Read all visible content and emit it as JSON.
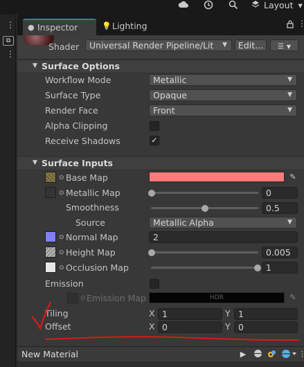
{
  "toolbar": {
    "cloud_icon": "cloud-icon",
    "history_icon": "history-icon",
    "search_icon": "search-icon",
    "layers_icon": "layers-icon",
    "layout_label": "Layout",
    "layout_arrow": "▾"
  },
  "tabs": {
    "inspector_label": "Inspector",
    "lighting_label": "Lighting",
    "lock_icon": "🔒",
    "menu_icon": "⋮"
  },
  "left_strip": {
    "kebab": "⋮",
    "scene_icon": "⧉"
  },
  "shader": {
    "label": "Shader",
    "value": "Universal Render Pipeline/Lit",
    "edit_button": "Edit...",
    "list_button": "☰"
  },
  "surface_options": {
    "title": "Surface Options",
    "workflow_mode_label": "Workflow Mode",
    "workflow_mode_value": "Metallic",
    "surface_type_label": "Surface Type",
    "surface_type_value": "Opaque",
    "render_face_label": "Render Face",
    "render_face_value": "Front",
    "alpha_clipping_label": "Alpha Clipping",
    "alpha_clipping_checked": false,
    "receive_shadows_label": "Receive Shadows",
    "receive_shadows_checked": true,
    "check_glyph": "✓"
  },
  "surface_inputs": {
    "title": "Surface Inputs",
    "base_map_label": "Base Map",
    "base_map_color": "#ff7b7b",
    "metallic_map_label": "Metallic Map",
    "metallic_value": "0",
    "metallic_fraction": 0.0,
    "smoothness_label": "Smoothness",
    "smoothness_value": "0.5",
    "smoothness_fraction": 0.5,
    "source_label": "Source",
    "source_value": "Metallic Alpha",
    "normal_map_label": "Normal Map",
    "normal_value": "2",
    "height_map_label": "Height Map",
    "height_value": "0.005",
    "height_fraction": 0.0,
    "occlusion_map_label": "Occlusion Map",
    "occlusion_value": "1",
    "occlusion_fraction": 1.0,
    "emission_label": "Emission",
    "emission_checked": false,
    "emission_map_label": "Emission Map",
    "emission_hdr_label": "HDR",
    "tiling_label": "Tiling",
    "tiling_x_label": "X",
    "tiling_x": "1",
    "tiling_y_label": "Y",
    "tiling_y": "1",
    "offset_label": "Offset",
    "offset_x_label": "X",
    "offset_x": "0",
    "offset_y_label": "Y",
    "offset_y": "0",
    "picker_glyph": "✎",
    "dot_glyph": "⊙"
  },
  "footer": {
    "title": "New Material",
    "play_icon": "▶"
  },
  "colors": {
    "accent_tab": "#3a79bb",
    "annotation_red": "#d81a1a",
    "base_map": "#ff7b7b"
  }
}
